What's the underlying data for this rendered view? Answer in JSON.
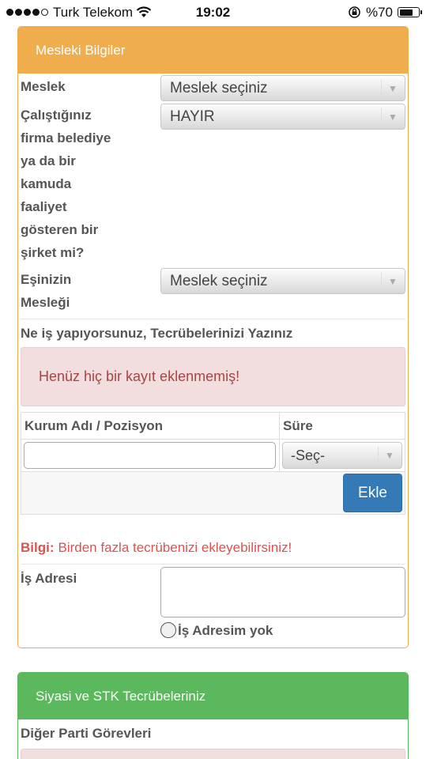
{
  "status_bar": {
    "carrier": "Turk Telekom",
    "time": "19:02",
    "battery": "%70",
    "battery_level": 0.7
  },
  "mesleki": {
    "title": "Mesleki Bilgiler",
    "meslek_label": "Meslek",
    "meslek_value": "Meslek seçiniz",
    "belediye_label_lines": [
      "Çalıştığınız",
      "firma belediye",
      "ya da bir",
      "kamuda",
      "faaliyet",
      "gösteren bir",
      "şirket mi?"
    ],
    "belediye_value": "HAYIR",
    "es_label_lines": [
      "Eşinizin",
      "Mesleği"
    ],
    "es_value": "Meslek seçiniz",
    "tecrube_heading": "Ne iş yapıyorsunuz, Tecrübelerinizi Yazınız",
    "alert": "Henüz hiç bir kayıt eklenmemiş!",
    "table": {
      "col_kurum": "Kurum Adı / Pozisyon",
      "col_sure": "Süre",
      "kurum_value": "",
      "sure_value": "-Seç-",
      "add_button": "Ekle"
    },
    "info_strong": "Bilgi:",
    "info_text": "Birden fazla tecrübenizi ekleyebilirsiniz!",
    "is_adresi_label": "İş Adresi",
    "is_adresi_value": "",
    "adres_yok_label": "İş Adresim yok"
  },
  "siyasi": {
    "title": "Siyasi ve STK Tecrübeleriniz",
    "diger_label": "Diğer Parti Görevleri"
  },
  "colors": {
    "orange": "#f0ad4e",
    "green": "#5cb85c",
    "primary": "#337ab7",
    "danger": "#a94442"
  }
}
